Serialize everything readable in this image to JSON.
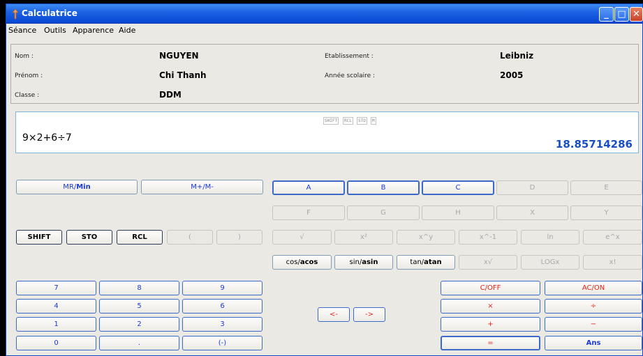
{
  "window": {
    "title": "Calculatrice"
  },
  "menu": [
    "Séance",
    "Outils",
    "Apparence",
    "Aide"
  ],
  "info": {
    "nom_label": "Nom :",
    "nom": "NGUYEN",
    "prenom_label": "Prénom :",
    "prenom": "Chi Thanh",
    "classe_label": "Classe :",
    "classe": "DDM",
    "etab_label": "Etablissement :",
    "etab": "Leibniz",
    "annee_label": "Année scolaire :",
    "annee": "2005"
  },
  "display": {
    "flags": [
      "SHIFT",
      "RCL",
      "STO",
      "M"
    ],
    "expression": "9×2+6÷7",
    "result": "18.85714286"
  },
  "memory": {
    "mr": "MR/",
    "mr_hl": "Min",
    "mplus": "M+/M-"
  },
  "modes": {
    "shift": "SHIFT",
    "sto": "STO",
    "rcl": "RCL",
    "lparen": "(",
    "rparen": ")"
  },
  "vars_row1": [
    "A",
    "B",
    "C",
    "D",
    "E"
  ],
  "vars_row2": [
    "F",
    "G",
    "H",
    "X",
    "Y"
  ],
  "funcs": [
    "√",
    "x²",
    "x^y",
    "x^-1",
    "ln",
    "e^x"
  ],
  "trig": [
    {
      "a": "cos/",
      "b": "acos"
    },
    {
      "a": "sin/",
      "b": "asin"
    },
    {
      "a": "tan/",
      "b": "atan"
    }
  ],
  "funcs2": [
    "x√",
    "LOGx",
    "x!"
  ],
  "digits": [
    [
      "7",
      "8",
      "9"
    ],
    [
      "4",
      "5",
      "6"
    ],
    [
      "1",
      "2",
      "3"
    ],
    [
      "0",
      ".",
      "(-)"
    ]
  ],
  "arrows": {
    "left": "<-",
    "right": "->"
  },
  "ops": {
    "c_off": "C/OFF",
    "ac_on": "AC/ON",
    "mul": "×",
    "div": "÷",
    "plus": "+",
    "minus": "−",
    "equals": "=",
    "ans": "Ans"
  },
  "colors": {
    "titlebar": "#0a4ad6",
    "accent_blue": "#1a39d6",
    "accent_red": "#e02418",
    "result_blue": "#1a4fc2"
  }
}
